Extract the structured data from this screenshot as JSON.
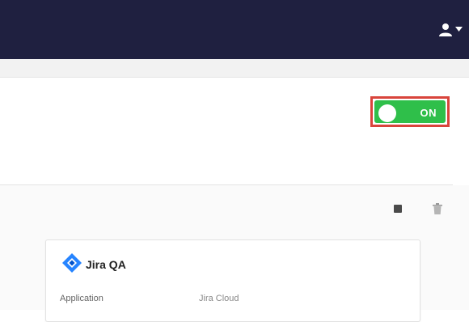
{
  "header": {
    "user_menu_icon": "user-icon",
    "caret_icon": "caret-down-icon",
    "background": "#1f2040"
  },
  "toggle": {
    "label": "ON",
    "state": "on",
    "accent": "#2fbf4a",
    "highlight": "#d9443b"
  },
  "actions": {
    "items": [
      {
        "icon": "square-icon"
      },
      {
        "icon": "trash-icon"
      }
    ]
  },
  "card": {
    "logo_icon": "jira-logo-icon",
    "title": "Jira QA",
    "field_label": "Application",
    "field_value": "Jira Cloud"
  }
}
